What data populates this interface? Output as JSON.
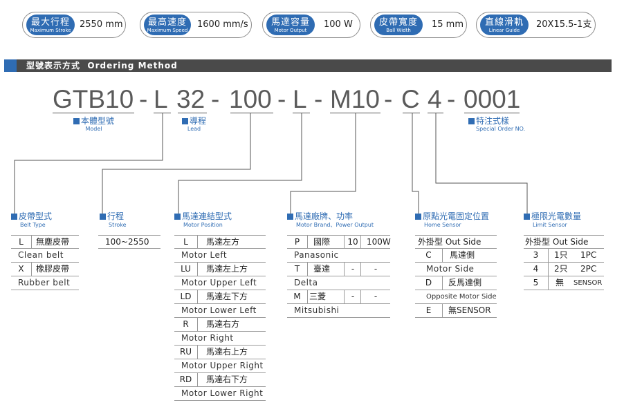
{
  "specs": [
    {
      "zh": "最大行程",
      "en": "Maximum Stroke",
      "value": "2550 mm"
    },
    {
      "zh": "最高速度",
      "en": "Maximum Speed",
      "value": "1600 mm/s"
    },
    {
      "zh": "馬達容量",
      "en": "Motor Output",
      "value": "100 W"
    },
    {
      "zh": "皮帶寬度",
      "en": "Ball Width",
      "value": "15 mm"
    },
    {
      "zh": "直線滑軌",
      "en": "Linear Guide",
      "value": "20X15.5-1支"
    }
  ],
  "section": {
    "zh": "型號表示方式",
    "en": "Ordering Method"
  },
  "code": {
    "model": "GTB10",
    "belt": "L",
    "lead": "32",
    "stroke": "100",
    "position": "L",
    "brand": "M10",
    "home": "C",
    "limit": "4",
    "special": "0001",
    "dash": "-"
  },
  "code_labels": {
    "model": {
      "zh": "本體型號",
      "en": "Model"
    },
    "lead": {
      "zh": "導程",
      "en": "Lead"
    },
    "special": {
      "zh": "特注式樣",
      "en": "Special Order NO."
    }
  },
  "groups": {
    "belt": {
      "zh": "皮帶型式",
      "en": "Belt Type"
    },
    "stroke": {
      "zh": "行程",
      "en": "Stroke"
    },
    "position": {
      "zh": "馬達連結型式",
      "en": "Motor Position"
    },
    "brand": {
      "zh": "馬達廠牌、功率",
      "en": "Motor Brand、Power Output"
    },
    "home": {
      "zh": "原點光電固定位置",
      "en": "Home Sensor"
    },
    "limit": {
      "zh": "極限光電數量",
      "en": "Limit Sensor"
    }
  },
  "belt_rows": [
    {
      "code": "L",
      "zh": "無塵皮帶",
      "en": "Clean belt"
    },
    {
      "code": "X",
      "zh": "橡膠皮帶",
      "en": "Rubber belt"
    }
  ],
  "stroke_range": "100~2550",
  "position_rows": [
    {
      "code": "L",
      "zh": "馬達左方",
      "en": "Motor Left"
    },
    {
      "code": "LU",
      "zh": "馬達左上方",
      "en": "Motor Upper Left"
    },
    {
      "code": "LD",
      "zh": "馬達左下方",
      "en": "Motor Lower Left"
    },
    {
      "code": "R",
      "zh": "馬達右方",
      "en": "Motor Right"
    },
    {
      "code": "RU",
      "zh": "馬達右上方",
      "en": "Motor Upper Right"
    },
    {
      "code": "RD",
      "zh": "馬達右下方",
      "en": "Motor Lower Right"
    }
  ],
  "brand_rows": [
    {
      "code": "P",
      "zh": "國際",
      "size": "10",
      "power": "100W",
      "en": "Panasonic"
    },
    {
      "code": "T",
      "zh": "臺達",
      "size": "-",
      "power": "-",
      "en": "Delta"
    },
    {
      "code": "M",
      "zh": "三菱",
      "size": "-",
      "power": "-",
      "en": "Mitsubishi"
    }
  ],
  "home": {
    "header": "外掛型 Out Side",
    "rows": [
      {
        "code": "C",
        "zh": "馬達側",
        "en": "Motor Side"
      },
      {
        "code": "D",
        "zh": "反馬達側",
        "en": "Opposite Motor Side"
      },
      {
        "code": "E",
        "zh": "無SENSOR",
        "en": ""
      }
    ]
  },
  "limit": {
    "header": "外掛型 Out Side",
    "rows": [
      {
        "code": "3",
        "zh": "1只",
        "en": "1PC"
      },
      {
        "code": "4",
        "zh": "2只",
        "en": "2PC"
      },
      {
        "code": "5",
        "zh": "無",
        "en": "SENSOR"
      }
    ]
  },
  "colors": {
    "accent": "#2f6cb3",
    "bar": "#4a4a4a",
    "line": "#555555",
    "code_text": "#5a5a5a"
  }
}
